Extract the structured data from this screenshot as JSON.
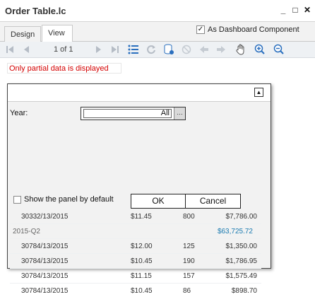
{
  "window": {
    "title": "Order Table.lc"
  },
  "tabs": [
    {
      "label": "Design"
    },
    {
      "label": "View"
    }
  ],
  "dashboard": {
    "label": "As Dashboard Component",
    "checked": true
  },
  "toolbar": {
    "page_info": "1 of 1"
  },
  "notice": {
    "text": "Only partial data is displayed"
  },
  "panel": {
    "year_label": "Year:",
    "year_value": "All",
    "show_default_label": "Show the panel by default",
    "ok_label": "OK",
    "cancel_label": "Cancel"
  },
  "table": {
    "rows": [
      {
        "type": "data",
        "id": "3033",
        "date": "2/13/2015",
        "price": "$11.45",
        "qty": "800",
        "total": "$7,786.00"
      },
      {
        "type": "group",
        "label": "2015-Q2",
        "total": "$63,725.72"
      },
      {
        "type": "data",
        "id": "3078",
        "date": "4/13/2015",
        "price": "$12.00",
        "qty": "125",
        "total": "$1,350.00"
      },
      {
        "type": "data",
        "id": "3078",
        "date": "4/13/2015",
        "price": "$10.45",
        "qty": "190",
        "total": "$1,786.95"
      },
      {
        "type": "data",
        "id": "3078",
        "date": "4/13/2015",
        "price": "$11.15",
        "qty": "157",
        "total": "$1,575.49"
      },
      {
        "type": "data",
        "id": "3078",
        "date": "4/13/2015",
        "price": "$10.45",
        "qty": "86",
        "total": "$898.70"
      }
    ]
  },
  "colors": {
    "notice": "#d40000",
    "group_total": "#1a7ab0",
    "toolbar_active": "#2a6fbe"
  }
}
